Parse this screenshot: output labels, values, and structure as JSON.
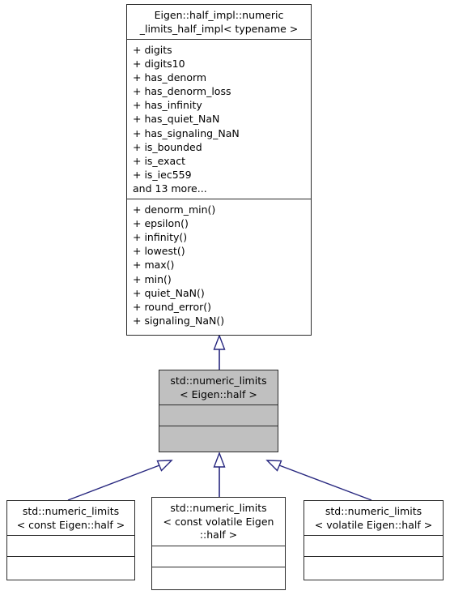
{
  "diagram": {
    "type": "uml-class-inheritance",
    "edge_color": "#27277f",
    "highlight_fill": "#c0c0c0",
    "border_color": "#2b2b2b",
    "background": "#ffffff"
  },
  "classes": {
    "base": {
      "title": "Eigen::half_impl::numeric\n_limits_half_impl< typename >",
      "attributes": [
        "+ digits",
        "+ digits10",
        "+ has_denorm",
        "+ has_denorm_loss",
        "+ has_infinity",
        "+ has_quiet_NaN",
        "+ has_signaling_NaN",
        "+ is_bounded",
        "+ is_exact",
        "+ is_iec559",
        "and 13 more..."
      ],
      "methods": [
        "+ denorm_min()",
        "+ epsilon()",
        "+ infinity()",
        "+ lowest()",
        "+ max()",
        "+ min()",
        "+ quiet_NaN()",
        "+ round_error()",
        "+ signaling_NaN()"
      ]
    },
    "focus": {
      "title": "std::numeric_limits\n< Eigen::half >",
      "attributes": [],
      "methods": []
    },
    "derived_const": {
      "title": "std::numeric_limits\n< const Eigen::half >",
      "attributes": [],
      "methods": []
    },
    "derived_const_volatile": {
      "title": "std::numeric_limits\n< const volatile Eigen\n::half >",
      "attributes": [],
      "methods": []
    },
    "derived_volatile": {
      "title": "std::numeric_limits\n< volatile Eigen::half >",
      "attributes": [],
      "methods": []
    }
  }
}
